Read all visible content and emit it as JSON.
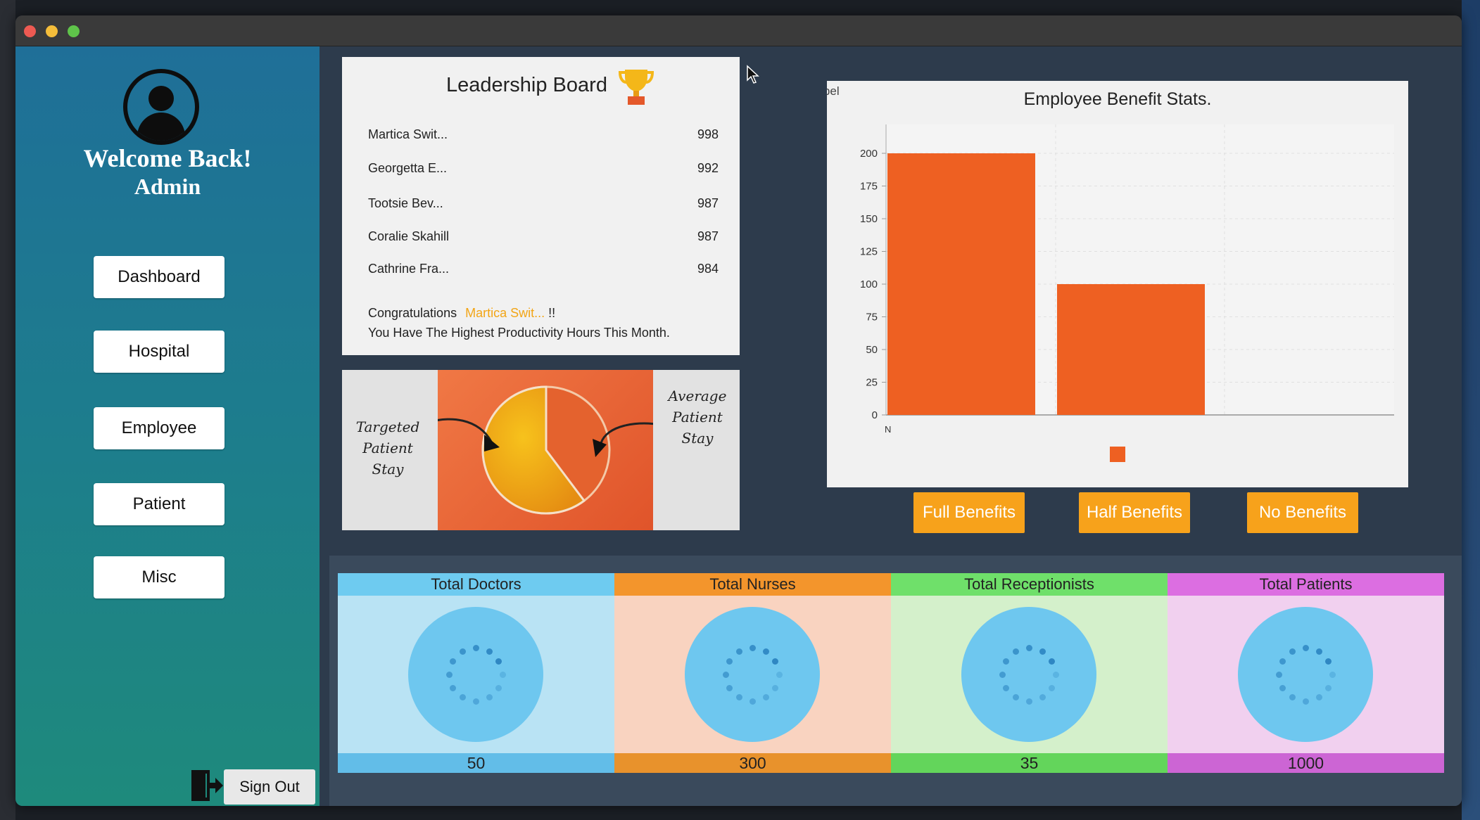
{
  "sidebar": {
    "welcome": "Welcome Back!",
    "role": "Admin",
    "nav": [
      "Dashboard",
      "Hospital",
      "Employee",
      "Patient",
      "Misc"
    ],
    "signout": "Sign Out"
  },
  "leaderboard": {
    "title": "Leadership Board",
    "rows": [
      {
        "name": "Martica Swit...",
        "score": "998"
      },
      {
        "name": "Georgetta E...",
        "score": "992"
      },
      {
        "name": "Tootsie Bev...",
        "score": "987"
      },
      {
        "name": "Coralie Skahill",
        "score": "987"
      },
      {
        "name": "Cathrine Fra...",
        "score": "984"
      }
    ],
    "congrats_prefix": "Congratulations",
    "congrats_name": "Martica Swit...",
    "congrats_suffix": "!!",
    "congrats_line2": "You Have The Highest Productivity Hours This Month."
  },
  "pie": {
    "left_label": [
      "Targeted",
      "Patient",
      "Stay"
    ],
    "right_label": [
      "Average",
      "Patient",
      "Stay"
    ]
  },
  "chart_data": {
    "type": "bar",
    "title": "Employee Benefit Stats.",
    "corner_label": "Label",
    "categories": [
      "N"
    ],
    "values": [
      200,
      100
    ],
    "ylim": [
      0,
      200
    ],
    "yticks": [
      0,
      25,
      50,
      75,
      100,
      125,
      150,
      175,
      200
    ],
    "grid": true,
    "bar_color": "#ee6022"
  },
  "benefit_buttons": [
    "Full Benefits",
    "Half Benefits",
    "No Benefits"
  ],
  "stats": [
    {
      "label": "Total Doctors",
      "value": "50",
      "head": "#6ecbf0",
      "body": "#b9e3f4",
      "foot": "#62bde8"
    },
    {
      "label": "Total Nurses",
      "value": "300",
      "head": "#f3952c",
      "body": "#f9d3c0",
      "foot": "#e8922c"
    },
    {
      "label": "Total Receptionists",
      "value": "35",
      "head": "#6fe06a",
      "body": "#d4f0cb",
      "foot": "#63d55b"
    },
    {
      "label": "Total Patients",
      "value": "1000",
      "head": "#dc6ee1",
      "body": "#f1d0ef",
      "foot": "#cc65d4"
    }
  ],
  "colors": {
    "accent_orange": "#f7a21b",
    "winner_highlight": "#f2a516"
  }
}
